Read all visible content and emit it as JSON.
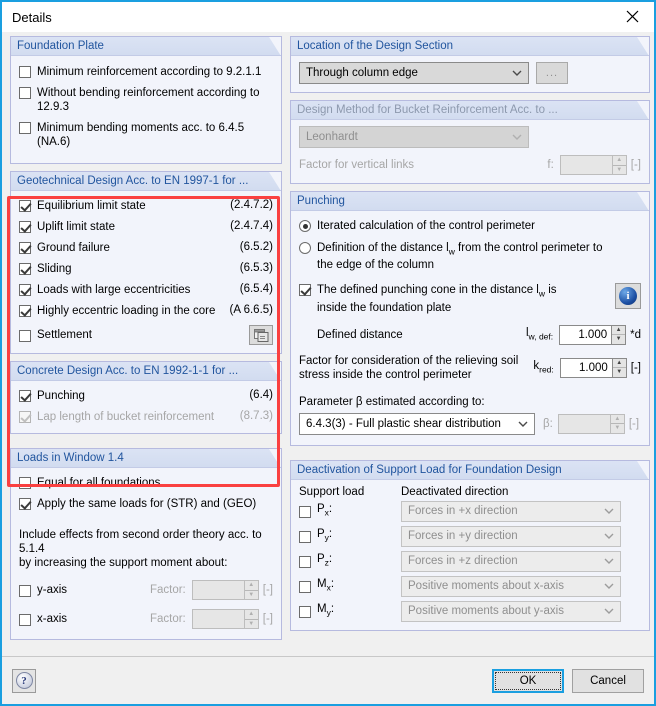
{
  "window": {
    "title": "Details",
    "close_icon": "close-icon"
  },
  "foundation_plate": {
    "header": "Foundation Plate",
    "items": [
      {
        "label": "Minimum reinforcement according to 9.2.1.1",
        "checked": false
      },
      {
        "label": "Without bending reinforcement according to 12.9.3",
        "checked": false
      },
      {
        "label": "Minimum bending moments acc. to 6.4.5 (NA.6)",
        "checked": false
      }
    ]
  },
  "geotechnical": {
    "header": "Geotechnical Design Acc. to EN 1997-1 for ...",
    "items": [
      {
        "label": "Equilibrium limit state",
        "ref": "(2.4.7.2)",
        "checked": true
      },
      {
        "label": "Uplift limit state",
        "ref": "(2.4.7.4)",
        "checked": true
      },
      {
        "label": "Ground failure",
        "ref": "(6.5.2)",
        "checked": true
      },
      {
        "label": "Sliding",
        "ref": "(6.5.3)",
        "checked": true
      },
      {
        "label": "Loads with large eccentricities",
        "ref": "(6.5.4)",
        "checked": true
      },
      {
        "label": "Highly eccentric loading in the core",
        "ref": "(A 6.6.5)",
        "checked": true
      },
      {
        "label": "Settlement",
        "ref": "",
        "checked": false
      }
    ],
    "settings_icon": "settings-table-icon"
  },
  "concrete": {
    "header": "Concrete Design Acc. to EN 1992-1-1 for ...",
    "items": [
      {
        "label": "Punching",
        "ref": "(6.4)",
        "checked": true,
        "disabled": false
      },
      {
        "label": "Lap length of bucket reinforcement",
        "ref": "(8.7.3)",
        "checked": true,
        "disabled": true
      }
    ]
  },
  "loads_window": {
    "header": "Loads in Window 1.4",
    "items": [
      {
        "label": "Equal for all foundations",
        "checked": false
      },
      {
        "label": "Apply the same loads for (STR) and (GEO)",
        "checked": true
      }
    ],
    "note_line1": "Include effects from second order theory acc. to 5.1.4",
    "note_line2": "by increasing the support moment about:",
    "axes": [
      {
        "label": "y-axis",
        "checked": false,
        "factor_label": "Factor:",
        "factor_value": "",
        "unit": "[-]"
      },
      {
        "label": "x-axis",
        "checked": false,
        "factor_label": "Factor:",
        "factor_value": "",
        "unit": "[-]"
      }
    ]
  },
  "location_section": {
    "header": "Location of the Design Section",
    "combo_value": "Through column edge",
    "dots_label": "...",
    "chevron_icon": "chevron-down-icon"
  },
  "bucket_method": {
    "header": "Design Method for Bucket Reinforcement Acc. to ...",
    "combo_value": "Leonhardt",
    "factor_label": "Factor for vertical links",
    "factor_symbol": "f:",
    "factor_value": "",
    "unit": "[-]"
  },
  "punching": {
    "header": "Punching",
    "radios": [
      {
        "label": "Iterated calculation of the control perimeter",
        "selected": true
      },
      {
        "label_part1": "Definition of the distance l",
        "label_sub": "w",
        "label_part2": " from the control perimeter to",
        "label_line2": "the edge of the column",
        "selected": false
      }
    ],
    "cone_checkbox": {
      "checked": true,
      "line1_part1": "The defined punching cone in the distance l",
      "line1_sub": "w",
      "line1_part2": " is",
      "line2": "inside the foundation plate"
    },
    "info_icon": "info-icon",
    "defined_distance": {
      "label": "Defined distance",
      "symbol_main": "l",
      "symbol_sub": "w, def:",
      "value": "1.000",
      "unit": "*d"
    },
    "k_red": {
      "label_line1": "Factor for consideration of the relieving soil",
      "label_line2": "stress inside the control perimeter",
      "symbol_main": "k",
      "symbol_sub": "red:",
      "value": "1.000",
      "unit": "[-]"
    },
    "beta": {
      "label_part1": "Parameter ",
      "label_symbol": "β",
      "label_part2": " estimated according to:",
      "combo_value": "6.4.3(3) - Full plastic shear distribution",
      "symbol": "β:",
      "value": "",
      "unit": "[-]"
    }
  },
  "deactivation": {
    "header": "Deactivation of Support Load for Foundation Design",
    "col1_header": "Support load",
    "col2_header": "Deactivated direction",
    "rows": [
      {
        "label_main": "P",
        "label_sub": "x",
        "label_suffix": ":",
        "checked": false,
        "direction": "Forces in +x direction"
      },
      {
        "label_main": "P",
        "label_sub": "y",
        "label_suffix": ":",
        "checked": false,
        "direction": "Forces in +y direction"
      },
      {
        "label_main": "P",
        "label_sub": "z",
        "label_suffix": ":",
        "checked": false,
        "direction": "Forces in +z direction"
      },
      {
        "label_main": "M",
        "label_sub": "x",
        "label_suffix": ":",
        "checked": false,
        "direction": "Positive moments about x-axis"
      },
      {
        "label_main": "M",
        "label_sub": "y",
        "label_suffix": ":",
        "checked": false,
        "direction": "Positive moments about y-axis"
      }
    ]
  },
  "footer": {
    "help_icon": "help-icon",
    "ok_label": "OK",
    "cancel_label": "Cancel"
  },
  "colors": {
    "highlight": "#fa4040",
    "accent": "#1a9fe0",
    "group_header_text": "#21559e"
  }
}
